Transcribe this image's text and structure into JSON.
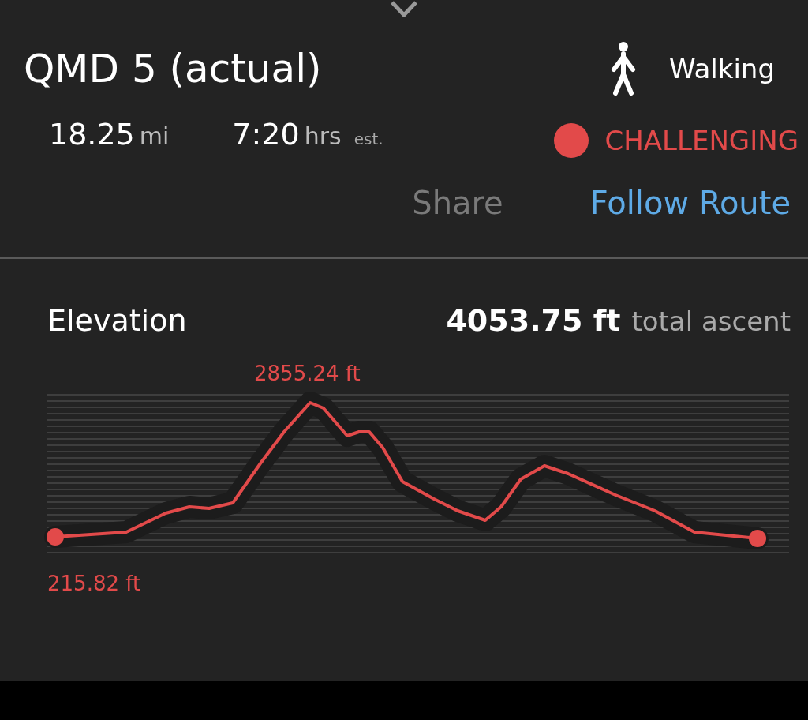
{
  "route": {
    "title": "QMD 5 (actual)",
    "activity": "Walking",
    "distance": {
      "value": "18.25",
      "unit": "mi"
    },
    "duration": {
      "value": "7:20",
      "unit": "hrs",
      "note": "est."
    },
    "difficulty": {
      "label": "CHALLENGING",
      "color": "#e24a4a"
    }
  },
  "actions": [
    {
      "label": "Share",
      "kind": "plain"
    },
    {
      "label": "Follow Route",
      "kind": "link"
    }
  ],
  "elevation": {
    "title": "Elevation",
    "total": "4053.75 ft",
    "total_label": "total ascent",
    "max_label": "2855.24 ft",
    "min_label": "215.82 ft"
  }
}
